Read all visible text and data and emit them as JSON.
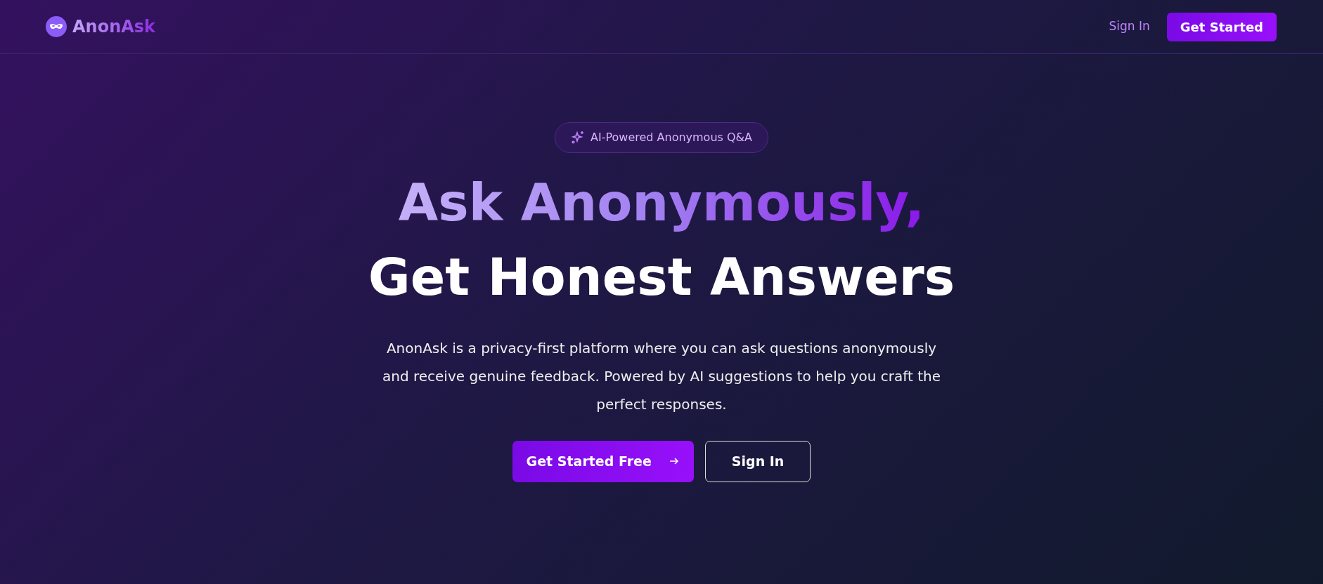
{
  "navbar": {
    "brand": "AnonAsk",
    "links": [
      {
        "label": "Sign In",
        "kind": "link"
      },
      {
        "label": "Get Started",
        "kind": "primary"
      }
    ]
  },
  "hero": {
    "badge": "AI-Powered Anonymous Q&A",
    "headline": [
      "Ask Anonymously,",
      "Get Honest Answers"
    ],
    "description": "AnonAsk is a privacy-first platform where you can ask questions anonymously and receive genuine feedback. Powered by AI suggestions to help you craft the perfect responses.",
    "buttons": [
      {
        "label": "Get Started Free",
        "kind": "primary",
        "arrow": true
      },
      {
        "label": "Sign In",
        "kind": "outline",
        "arrow": false
      }
    ]
  }
}
